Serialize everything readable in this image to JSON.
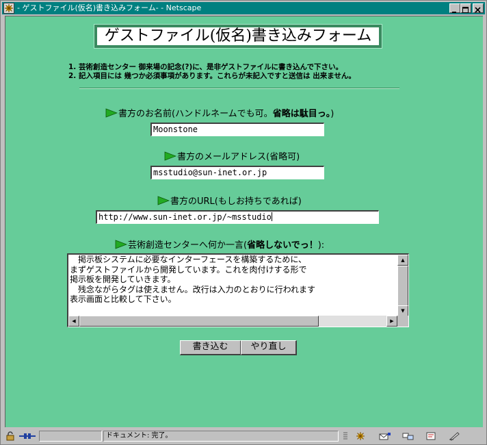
{
  "window": {
    "title": "- ゲストファイル(仮名)書き込みフォーム- - Netscape"
  },
  "page": {
    "headline": "ゲストファイル(仮名)書き込みフォーム",
    "notes": [
      "1. 芸術創造センター 御来場の記念(?)に、是非ゲストファイルに書き込んで下さい。",
      "2. 記入項目には 幾つか必須事項があります。これらが未記入ですと送信は 出来ません。"
    ]
  },
  "form": {
    "name_label": "書方のお名前(ハンドルネームでも可。",
    "name_label_bold": "省略は駄目っ。",
    "name_label_end": ")",
    "name_value": "Moonstone",
    "email_label": "書方のメールアドレス(省略可)",
    "email_value": "msstudio@sun-inet.or.jp",
    "url_label": "書方のURL(もしお持ちであれば)",
    "url_value": "http://www.sun-inet.or.jp/~msstudio",
    "comment_label": "芸術創造センターへ何か一言(",
    "comment_label_bold": "省略しないでっ！",
    "comment_label_end": "):",
    "comment_value": "　掲示板システムに必要なインターフェースを構築するために、\nまずゲストファイルから開発しています。これを肉付けする形で\n掲示板を開発していきます。\n　残念ながらタグは使えません。改行は入力のとおりに行われます\n表示画面と比較して下さい。",
    "submit_label": "書き込む",
    "reset_label": "やり直し"
  },
  "status": {
    "message": "ドキュメント: 完了。"
  },
  "colors": {
    "page_background": "#66cc99",
    "title_bar": "#008080",
    "arrow": "#22aa22"
  },
  "icons": [
    "app-icon",
    "minimize-icon",
    "maximize-icon",
    "close-icon",
    "lock-icon",
    "connection-icon",
    "green-arrow-icon",
    "netscape-icon",
    "mail-icon",
    "discussion-icon",
    "composer-icon",
    "bookmark-icon"
  ]
}
